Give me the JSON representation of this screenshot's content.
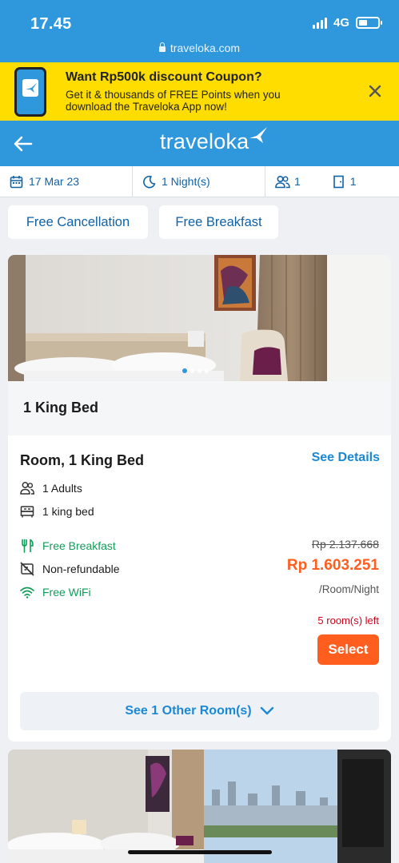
{
  "status_bar": {
    "time": "17.45",
    "network": "4G",
    "url": "traveloka.com"
  },
  "promo": {
    "title": "Want Rp500k discount Coupon?",
    "subtitle": "Get it & thousands of FREE Points when you download the Traveloka App now!"
  },
  "header": {
    "logo_text": "traveloka"
  },
  "search_summary": {
    "date": "17 Mar 23",
    "nights": "1 Night(s)",
    "guests": "1",
    "rooms": "1"
  },
  "filters": [
    "Free Cancellation",
    "Free Breakfast"
  ],
  "room_card": {
    "bed_title": "1 King Bed",
    "room_name": "Room, 1 King Bed",
    "see_details": "See Details",
    "adults": "1 Adults",
    "bed": "1 king bed",
    "benefits": [
      "Free Breakfast",
      "Non-refundable",
      "Free WiFi"
    ],
    "original_price": "Rp 2.137.668",
    "price": "Rp 1.603.251",
    "price_unit": "/Room/Night",
    "rooms_left": "5 room(s) left",
    "select_label": "Select",
    "other_rooms": "See 1 Other Room(s)",
    "photo_index": 1,
    "photo_count": 4
  },
  "colors": {
    "brand_blue": "#2f97dc",
    "promo_yellow": "#ffdd00",
    "price_orange": "#ff5e1f",
    "benefit_green": "#0f9d58",
    "urgent_red": "#d0021b"
  }
}
